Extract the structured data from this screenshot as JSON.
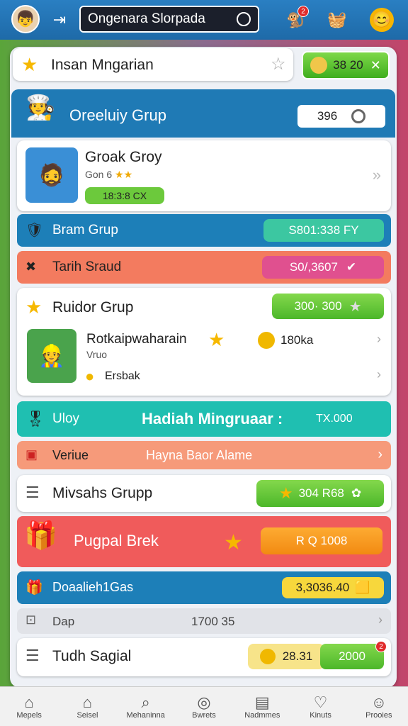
{
  "header": {
    "search_text": "Ongenara Slorpada",
    "notif_count": "2"
  },
  "title_bar": {
    "title": "Insan Mngarian",
    "coin_value": "38 20"
  },
  "group": {
    "title": "Oreeluiy Grup",
    "count": "396"
  },
  "featured": {
    "title": "Groak Groy",
    "sub": "Gon 6",
    "timer": "18:3:8 CX"
  },
  "rows": {
    "bram": {
      "label": "Bram Grup",
      "value": "S801:338 FY"
    },
    "tarih": {
      "label": "Tarih Sraud",
      "value": "S0/,3607"
    },
    "ruidor": {
      "label": "Ruidor Grup",
      "value": "300· 300"
    }
  },
  "sub_item": {
    "title": "Rotkaipwaharain",
    "tag": "Vruo",
    "coins": "180ka",
    "extra": "Ersbak"
  },
  "weekly": {
    "left": "Uloy",
    "title": "Hadiah Mingruaar :",
    "amount": "TX.000"
  },
  "veriue": {
    "label": "Veriue",
    "text": "Hayna Baor Alame"
  },
  "mivsahs": {
    "label": "Mivsahs Grupp",
    "value": "304 R68"
  },
  "pugpal": {
    "label": "Pugpal Brek",
    "value": "R Q 1008"
  },
  "dosalie": {
    "label": "Doaalieh1Gas",
    "value": "3,3036.40"
  },
  "dap": {
    "label": "Dap",
    "value": "1700 35"
  },
  "tudh": {
    "label": "Tudh Sagial",
    "value1": "28.31",
    "value2": "2000",
    "badge": "2"
  },
  "bottom_nav": [
    {
      "label": "Mepels",
      "icon": "home-icon"
    },
    {
      "label": "Seisel",
      "icon": "house-icon"
    },
    {
      "label": "Mehaninna",
      "icon": "search-icon"
    },
    {
      "label": "Bwrets",
      "icon": "shield-icon"
    },
    {
      "label": "Nadmmes",
      "icon": "list-icon"
    },
    {
      "label": "Kinuts",
      "icon": "heart-icon"
    },
    {
      "label": "Prooies",
      "icon": "user-icon"
    }
  ]
}
